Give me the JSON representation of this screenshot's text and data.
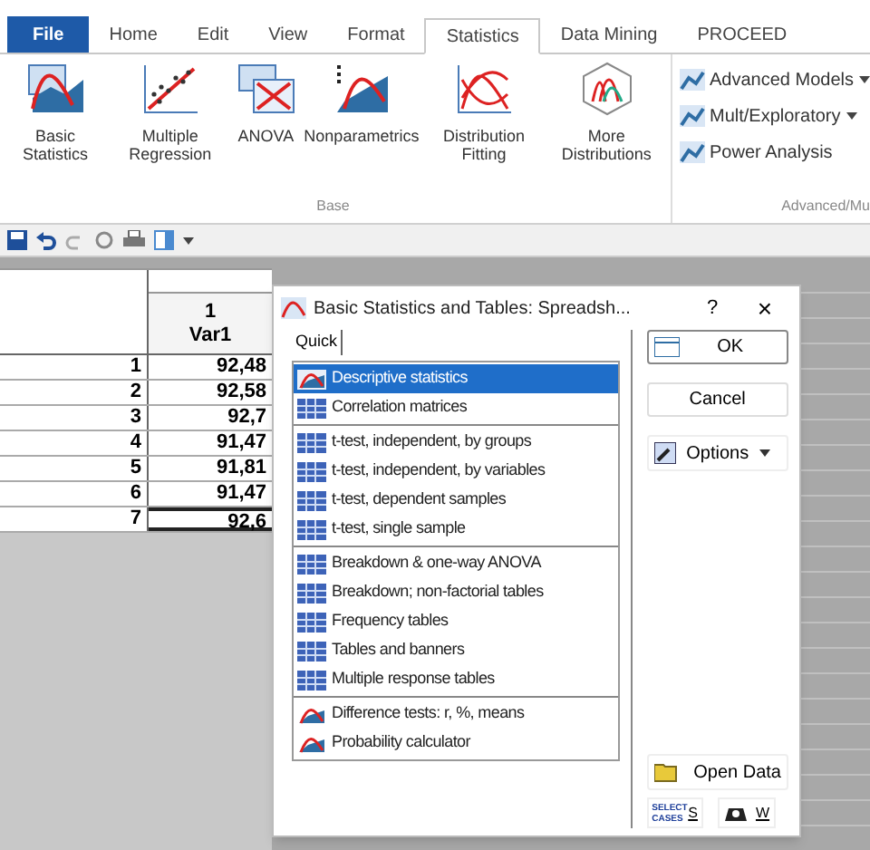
{
  "menu_tabs": [
    {
      "label": "File",
      "kind": "file",
      "selected": false
    },
    {
      "label": "Home",
      "kind": "tab",
      "selected": false
    },
    {
      "label": "Edit",
      "kind": "tab",
      "selected": false
    },
    {
      "label": "View",
      "kind": "tab",
      "selected": false
    },
    {
      "label": "Format",
      "kind": "tab",
      "selected": false
    },
    {
      "label": "Statistics",
      "kind": "tab",
      "selected": true
    },
    {
      "label": "Data Mining",
      "kind": "tab",
      "selected": false
    },
    {
      "label": "PROCEED",
      "kind": "tab",
      "selected": false
    }
  ],
  "ribbon": {
    "base_group": {
      "label": "Base",
      "buttons": [
        {
          "label": "Basic Statistics",
          "kind": "basic"
        },
        {
          "label": "Multiple Regression",
          "kind": "scatter"
        },
        {
          "label": "ANOVA",
          "kind": "anova"
        },
        {
          "label": "Nonparametrics",
          "kind": "nonpar"
        },
        {
          "label": "Distribution Fitting",
          "kind": "fit"
        },
        {
          "label": "More Distributions",
          "kind": "more"
        }
      ]
    },
    "advanced_group": {
      "label": "Advanced/Mu",
      "buttons": [
        {
          "label": "Advanced Models",
          "dropdown": true
        },
        {
          "label": "Mult/Exploratory",
          "dropdown": true
        },
        {
          "label": "Power Analysis",
          "dropdown": false
        }
      ]
    }
  },
  "sheet": {
    "column": {
      "number": "1",
      "name": "Var1"
    },
    "rows": [
      {
        "index": "1",
        "value": "92,48",
        "selected": false
      },
      {
        "index": "2",
        "value": "92,58",
        "selected": false
      },
      {
        "index": "3",
        "value": "92,7",
        "selected": false
      },
      {
        "index": "4",
        "value": "91,47",
        "selected": false
      },
      {
        "index": "5",
        "value": "91,81",
        "selected": false
      },
      {
        "index": "6",
        "value": "91,47",
        "selected": false
      },
      {
        "index": "7",
        "value": "92,6",
        "selected": true
      }
    ]
  },
  "dialog": {
    "title": "Basic Statistics and Tables: Spreadsh...",
    "help": "?",
    "close": "×",
    "tab": "Quick",
    "groups": [
      [
        {
          "label": "Descriptive statistics",
          "selected": true
        },
        {
          "label": "Correlation matrices",
          "selected": false
        }
      ],
      [
        {
          "label": "t-test, independent, by groups",
          "selected": false
        },
        {
          "label": "t-test, independent, by variables",
          "selected": false
        },
        {
          "label": "t-test, dependent samples",
          "selected": false
        },
        {
          "label": "t-test, single sample",
          "selected": false
        }
      ],
      [
        {
          "label": "Breakdown & one-way ANOVA",
          "selected": false
        },
        {
          "label": "Breakdown; non-factorial tables",
          "selected": false
        },
        {
          "label": "Frequency tables",
          "selected": false
        },
        {
          "label": "Tables and banners",
          "selected": false
        },
        {
          "label": "Multiple response tables",
          "selected": false
        }
      ],
      [
        {
          "label": "Difference tests: r, %, means",
          "selected": false
        },
        {
          "label": "Probability calculator",
          "selected": false
        }
      ]
    ],
    "ok": "OK",
    "cancel": "Cancel",
    "options": "Options",
    "open_data": "Open Data",
    "select_cases": "SELECT CASES",
    "select_key": "S",
    "weight_key": "W"
  }
}
